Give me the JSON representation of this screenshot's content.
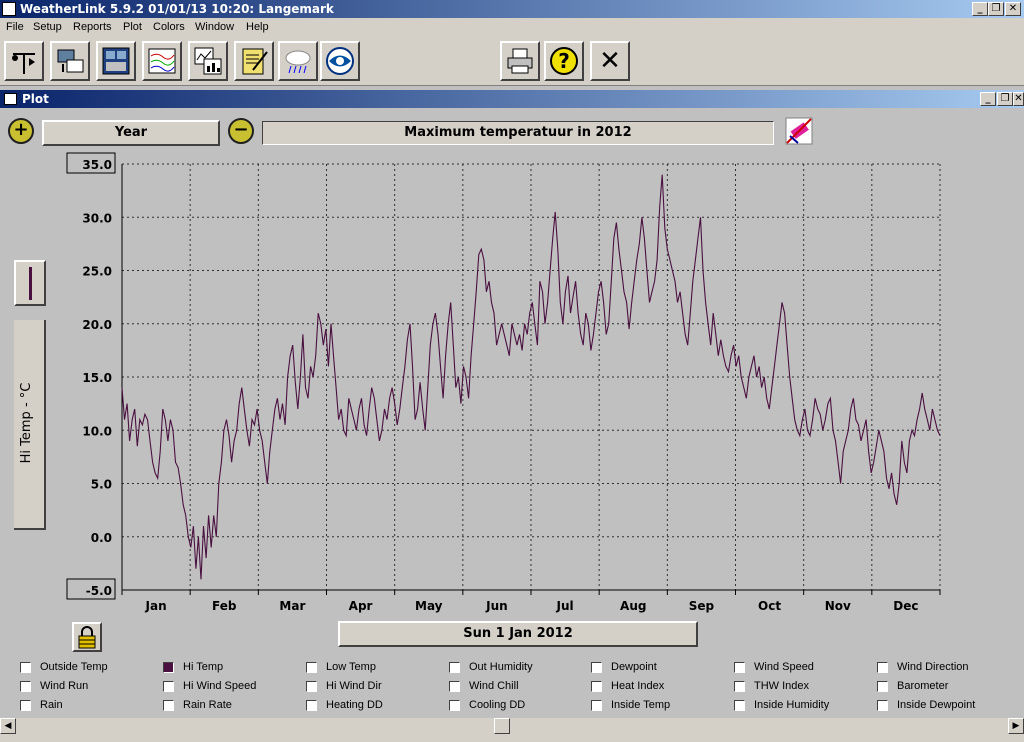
{
  "app": {
    "title": "WeatherLink 5.9.2  01/01/13  10:20: Langemark",
    "win_minimize": "_",
    "win_restore": "❐",
    "win_close": "✕"
  },
  "menu": [
    "File",
    "Setup",
    "Reports",
    "Plot",
    "Colors",
    "Window",
    "Help"
  ],
  "toolbar": {
    "buttons": [
      "station-icon",
      "download-icon",
      "bulletin-icon",
      "strip-chart-icon",
      "plot-icon",
      "notebook-icon",
      "weather-icon",
      "noaa-icon"
    ],
    "right": [
      "print-icon",
      "help-icon",
      "exit-icon"
    ],
    "help_label": "?",
    "exit_label": "✕"
  },
  "plot_window": {
    "title": "Plot",
    "zoom_in": "+",
    "zoom_out": "−",
    "span_label": "Year",
    "chart_title": "Maximum temperatuur in 2012",
    "date_label": "Sun 1 Jan 2012",
    "y_axis_label": "Hi Temp - °C"
  },
  "chart_data": {
    "type": "line",
    "title": "Maximum temperatuur in 2012",
    "xlabel": "",
    "ylabel": "Hi Temp - °C",
    "ylim": [
      -5,
      35
    ],
    "y_ticks": [
      "35.0",
      "30.0",
      "25.0",
      "20.0",
      "15.0",
      "10.0",
      "5.0",
      "0.0",
      "-5.0"
    ],
    "categories": [
      "Jan",
      "Feb",
      "Mar",
      "Apr",
      "May",
      "Jun",
      "Jul",
      "Aug",
      "Sep",
      "Oct",
      "Nov",
      "Dec"
    ],
    "grid": true,
    "series": [
      {
        "color": "#4a1040",
        "values": [
          14,
          11,
          12.5,
          9,
          11,
          12,
          8.5,
          11,
          10.5,
          11.5,
          11,
          9,
          7,
          6,
          5.5,
          8,
          12,
          11,
          9,
          11,
          10,
          7,
          6.5,
          5,
          3,
          2,
          0,
          -1,
          1,
          -3,
          0,
          -4,
          1,
          -2,
          2,
          -1,
          2,
          0,
          5,
          7,
          10,
          11,
          9.5,
          7,
          9,
          10,
          12.5,
          14,
          12,
          10,
          8.5,
          11,
          10.5,
          12,
          10,
          9,
          7,
          5,
          8,
          10,
          12,
          13,
          11,
          12.5,
          10.5,
          15,
          17,
          18,
          14.5,
          12,
          15,
          19,
          14,
          13,
          16,
          15,
          17,
          21,
          20,
          18,
          19.5,
          16,
          20,
          17,
          14,
          11,
          12,
          10,
          9.5,
          13,
          12,
          11,
          10,
          12,
          13,
          10.5,
          9.5,
          12,
          14,
          13,
          11,
          9,
          10,
          12,
          11,
          13,
          14,
          12.5,
          10.5,
          12,
          14,
          16,
          18.5,
          20,
          16,
          11,
          12,
          14.5,
          12,
          10,
          14,
          18,
          20,
          21,
          19,
          16,
          13,
          17,
          20,
          22,
          18,
          14,
          15,
          12.5,
          16,
          15,
          13,
          17,
          20,
          23,
          26.5,
          27,
          26,
          23,
          24,
          22,
          21,
          18,
          19,
          20,
          19,
          18,
          17,
          20,
          19,
          18,
          19,
          17.5,
          20,
          19,
          21,
          22,
          20,
          18,
          24,
          23,
          20,
          22,
          25,
          28,
          30.5,
          27,
          22,
          20,
          23,
          24.5,
          21,
          22.5,
          24,
          21,
          19,
          18,
          21,
          20,
          17.5,
          19,
          21,
          23,
          24,
          22,
          19,
          20,
          24,
          28,
          29.5,
          27,
          25,
          23,
          22,
          19.5,
          22,
          24,
          26,
          27.5,
          30,
          28,
          25,
          22,
          23,
          24,
          26,
          31,
          34,
          29,
          27,
          26,
          25,
          24,
          22,
          23,
          21,
          19,
          18,
          21,
          24,
          26,
          28,
          30,
          25,
          22,
          20,
          18,
          21,
          19,
          17,
          18.5,
          17,
          16,
          15.5,
          17,
          18,
          16,
          17,
          15,
          14,
          13,
          15,
          16,
          17,
          15,
          16,
          14,
          15,
          13,
          12,
          14,
          16,
          18,
          20,
          22,
          21,
          18,
          15,
          13,
          11,
          10,
          9.5,
          11,
          12,
          10,
          9.5,
          11,
          13,
          12,
          11.5,
          10,
          11,
          12.5,
          13,
          10,
          9,
          7,
          5,
          8,
          9,
          10,
          12,
          13,
          11,
          10.5,
          9,
          10,
          11,
          8,
          6,
          7,
          8.5,
          10,
          9,
          8,
          5.5,
          4.5,
          6,
          4,
          3,
          5,
          9,
          7,
          6,
          9,
          10,
          9.5,
          11,
          12,
          13.5,
          12,
          11,
          10,
          12,
          11,
          10,
          9.5
        ]
      }
    ]
  },
  "legend": [
    [
      "Outside Temp",
      "Hi Temp",
      "Low Temp",
      "Out Humidity",
      "Dewpoint",
      "Wind Speed",
      "Wind Direction"
    ],
    [
      "Wind Run",
      "Hi Wind Speed",
      "Hi Wind Dir",
      "Wind Chill",
      "Heat Index",
      "THW Index",
      "Barometer"
    ],
    [
      "Rain",
      "Rain Rate",
      "Heating DD",
      "Cooling DD",
      "Inside Temp",
      "Inside Humidity",
      "Inside Dewpoint"
    ]
  ],
  "legend_checked": "Hi Temp"
}
